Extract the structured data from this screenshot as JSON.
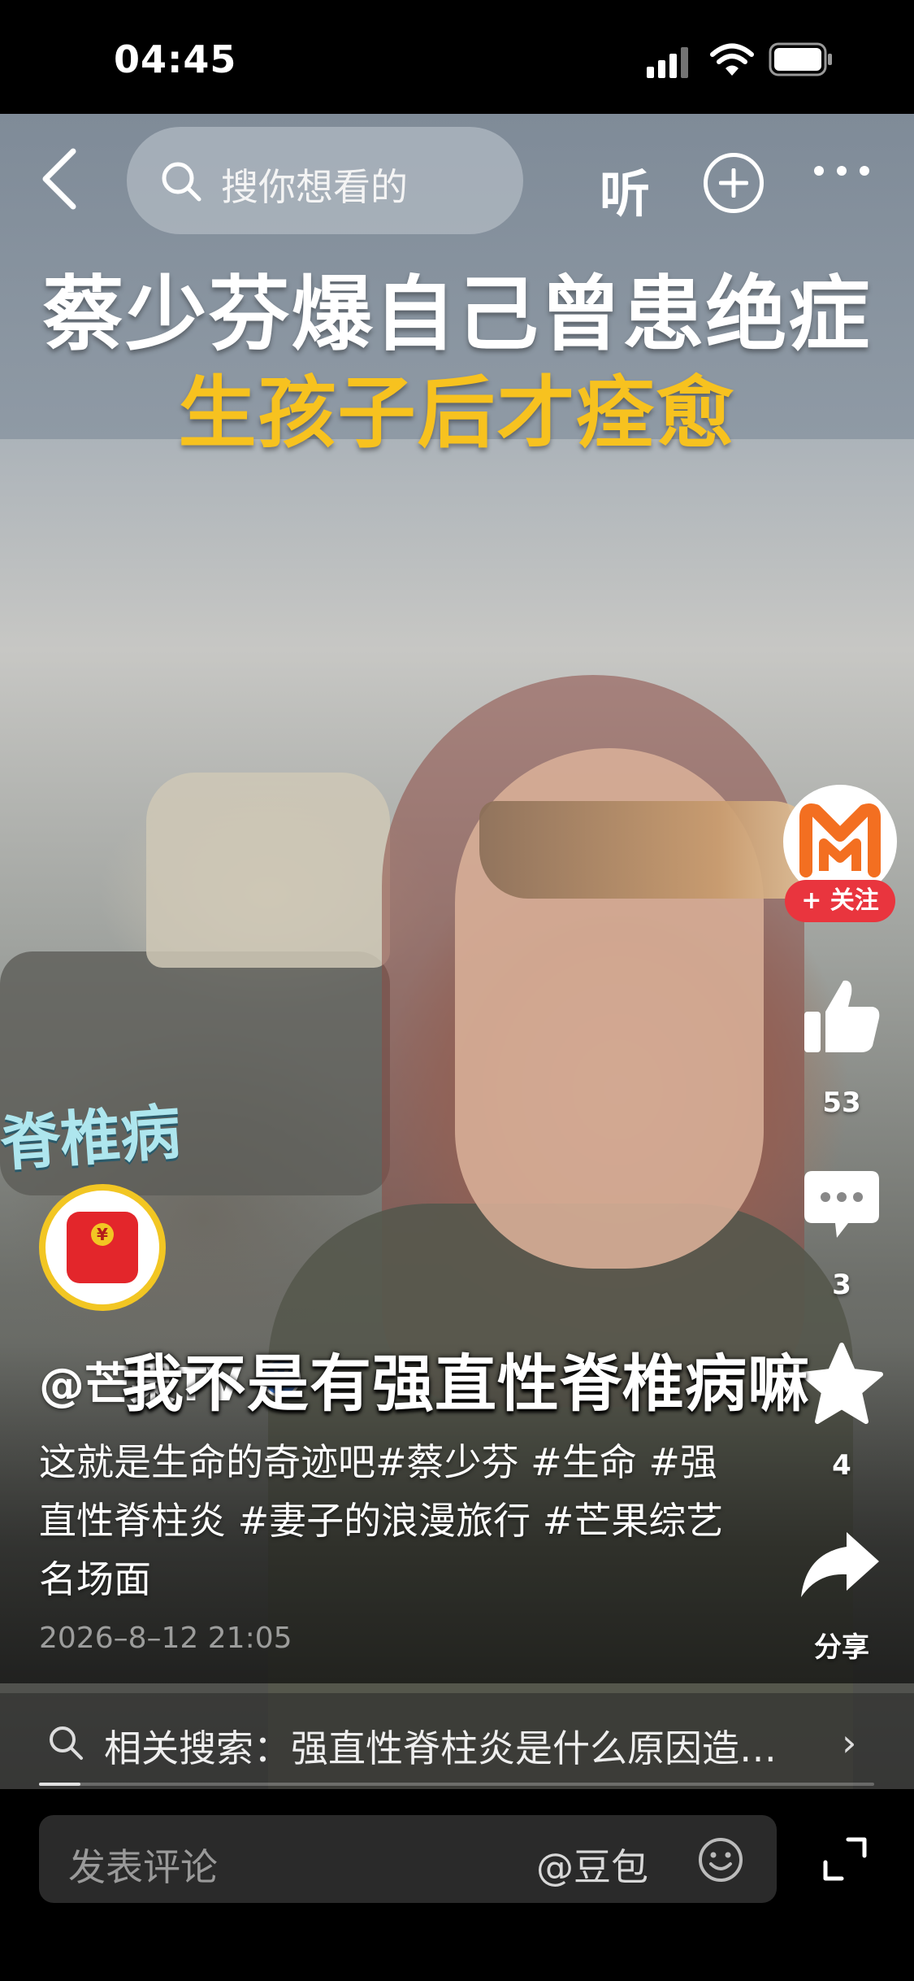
{
  "status_bar": {
    "time": "04:45"
  },
  "search": {
    "placeholder": "搜你想看的"
  },
  "top_actions": {
    "listen": "听"
  },
  "video": {
    "title_line1": "蔡少芬爆自己曾患绝症",
    "title_line2": "生孩子后才痊愈",
    "caption_side": "脊椎病",
    "caption_main": "我不是有强直性脊椎病嘛"
  },
  "author": {
    "name": "@芒果TV",
    "verified_badge": "V"
  },
  "description": "这就是生命的奇迹吧#蔡少芬 #生命 #强直性脊柱炎 #妻子的浪漫旅行 #芒果综艺名场面",
  "timestamp": "2026–8–12 21:05",
  "red_packet": {
    "symbol": "¥"
  },
  "rail": {
    "follow_label": "+ 关注",
    "likes": "53",
    "comments": "3",
    "favorites": "4",
    "share_label": "分享"
  },
  "related_search": {
    "text": "相关搜索：强直性脊柱炎是什么原因造…",
    "arrow": "›"
  },
  "progress": {
    "fraction": 0.05
  },
  "comment_bar": {
    "placeholder": "发表评论",
    "mention": "@豆包"
  },
  "colors": {
    "follow": "#e9353e",
    "title_yellow": "#f7c21f",
    "brand_orange": "#f36f21",
    "verified": "#4a8cf0"
  },
  "icons": [
    "back-icon",
    "search-icon",
    "plus-circle-icon",
    "more-icon",
    "mango-logo-icon",
    "thumbs-up-icon",
    "comment-icon",
    "star-icon",
    "share-icon",
    "red-packet-icon",
    "emoji-icon",
    "fullscreen-icon",
    "wifi-icon",
    "signal-icon",
    "battery-icon"
  ]
}
